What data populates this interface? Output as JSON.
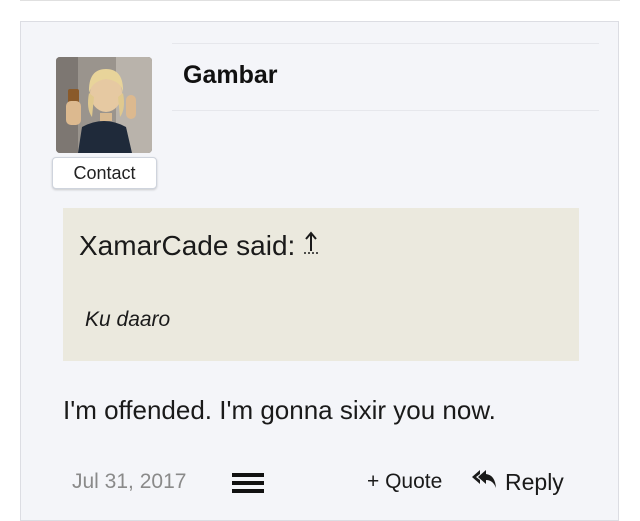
{
  "post": {
    "username": "Gambar",
    "contact_label": "Contact",
    "quote": {
      "author_said": "XamarCade said:",
      "jump_icon": "arrow-up-icon",
      "text": "Ku daaro"
    },
    "message": "I'm offended. I'm gonna sixir you now.",
    "footer": {
      "date": "Jul 31, 2017",
      "menu_icon": "hamburger-menu-icon",
      "quote_label": "+ Quote",
      "reply_label": "Reply",
      "reply_icon": "reply-all-icon"
    }
  },
  "colors": {
    "card_background": "#f4f5f9",
    "quote_background": "#ebe9de",
    "date_color": "#8a8a8a"
  }
}
